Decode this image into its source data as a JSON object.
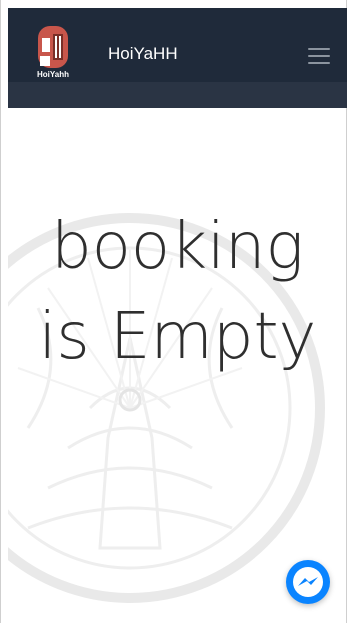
{
  "navbar": {
    "brand": "HoiYaHH",
    "logo_text": "HoiYahh",
    "menu_icon": "hamburger-menu-icon"
  },
  "main": {
    "empty_line1": "booking",
    "empty_line2": "is Empty"
  },
  "chat_widget": {
    "icon": "messenger-icon"
  },
  "colors": {
    "navbar_bg": "#1f2a3a",
    "accent": "#0a84ff"
  }
}
